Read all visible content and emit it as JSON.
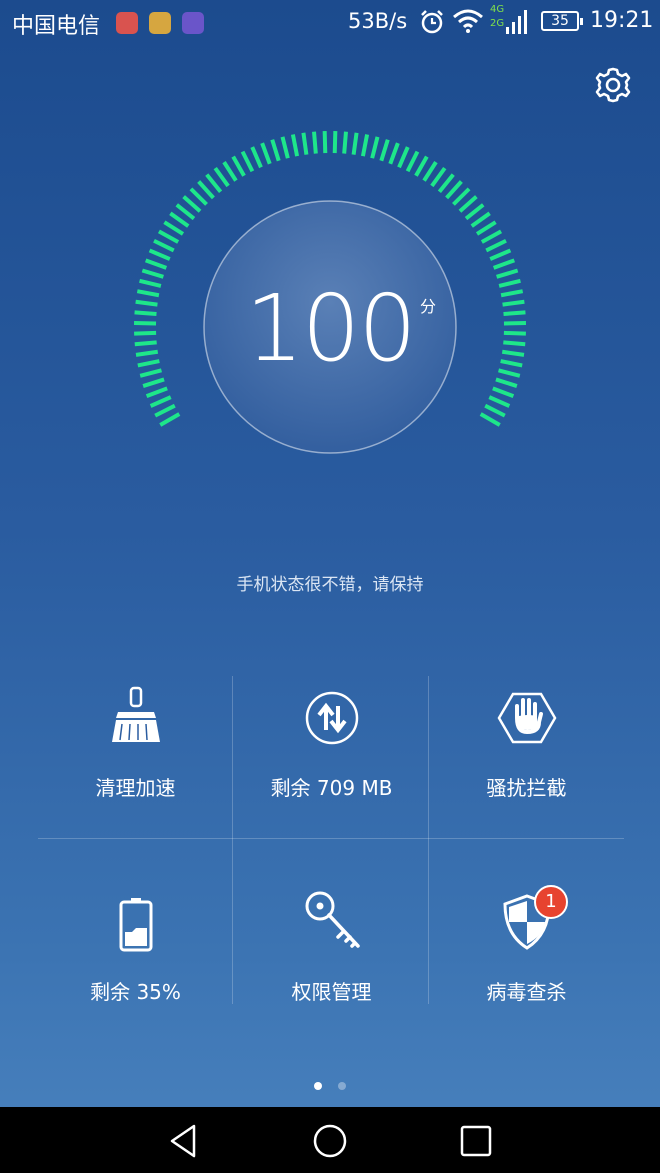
{
  "status_bar": {
    "carrier": "中国电信",
    "net_speed": "53B/s",
    "network_type_top": "4G",
    "network_type_bottom": "2G",
    "battery_level": "35",
    "time": "19:21"
  },
  "gauge": {
    "score": "100",
    "unit": "分",
    "progress": 1.0,
    "color_active": "#1ee68a"
  },
  "status_message": "手机状态很不错，请保持",
  "tiles": [
    {
      "label": "清理加速",
      "icon": "broom-icon"
    },
    {
      "label": "剩余 709 MB",
      "icon": "data-transfer-icon"
    },
    {
      "label": "骚扰拦截",
      "icon": "hand-stop-icon"
    },
    {
      "label": "剩余 35%",
      "icon": "battery-icon"
    },
    {
      "label": "权限管理",
      "icon": "key-icon"
    },
    {
      "label": "病毒查杀",
      "icon": "shield-icon"
    }
  ],
  "virus_badge": "1",
  "page_indicator": {
    "count": 2,
    "active": 0
  }
}
